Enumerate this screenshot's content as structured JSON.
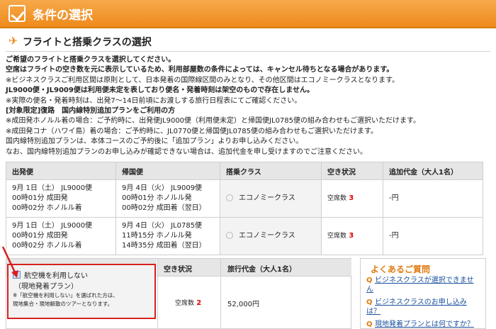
{
  "header": {
    "title": "条件の選択"
  },
  "subheader": {
    "title": "フライトと搭乗クラスの選択"
  },
  "intro": [
    {
      "text": "ご希望のフライトと搭乗クラスを選択してください。",
      "bold": true
    },
    {
      "text": "空席はフライトの空き数を元に表示しているため、利用部屋数の条件によっては、キャンセル待ちとなる場合があります。",
      "bold": true
    },
    {
      "text": "※ビジネスクラスご利用区間は原則として、日本発着の国際線区間のみとなり、その他区間はエコノミークラスとなります。",
      "bold": false
    },
    {
      "text": "JL9000便・JL9009便は利用便未定を表しており便名・発着時刻は架空のもので存在しません。",
      "bold": true
    },
    {
      "text": "※実際の便名・発着時刻は、出発7〜14日前頃にお渡しする旅行日程表にてご確認ください。",
      "bold": false
    },
    {
      "text": "[対象限定]復路　国内線特別追加プランをご利用の方",
      "bold": true
    },
    {
      "text": "※成田発ホノルル着の場合：ご予約時に、出発便JL9000便（利用便未定）と帰国便JL0785便の組み合わせもご選択いただけます。",
      "bold": false
    },
    {
      "text": "※成田発コナ（ハワイ島）着の場合：ご予約時に、JL0770便と帰国便JL0785便の組み合わせもご選択いただけます。",
      "bold": false
    },
    {
      "text": "国内線特別追加プランは、本体コースのご予約後に「追加プラン」よりお申し込みください。",
      "bold": false
    },
    {
      "text": "なお、国内線特別追加プランのお申し込みが確認できない場合は、追加代金を申し受けますのでご注意ください。",
      "bold": false
    }
  ],
  "flights": {
    "headers": [
      "出発便",
      "帰国便",
      "搭乗クラス",
      "空き状況",
      "追加代金（大人1名）"
    ],
    "rows": [
      {
        "out": [
          "9月 1日（土） JL9000便",
          "00時01分 成田発",
          "00時02分 ホノルル着"
        ],
        "ret": [
          "9月 4日（火） JL9009便",
          "00時01分 ホノルル発",
          "00時02分 成田着（翌日）"
        ],
        "cls": "エコノミークラス",
        "avail_label": "空席数",
        "avail": "3",
        "price": "-円"
      },
      {
        "out": [
          "9月 1日（土） JL9000便",
          "00時01分 成田発",
          "00時02分 ホノルル着"
        ],
        "ret": [
          "9月 4日（火） JL0785便",
          "11時15分 ホノルル発",
          "14時35分 成田着（翌日）"
        ],
        "cls": "エコノミークラス",
        "avail_label": "空席数",
        "avail": "3",
        "price": "-円"
      }
    ]
  },
  "plan": {
    "headers": {
      "avail": "空き状況",
      "price": "旅行代金（大人1名）"
    },
    "option_label": "航空機を利用しない",
    "option_sub": "（現地発着プラン）",
    "note1": "※「航空機を利用しない」を選ばれた方は、",
    "note2": "現地集合・現地解散のツアーとなります。",
    "avail_label": "空席数",
    "avail": "2",
    "price": "52,000円"
  },
  "faq": {
    "title": "よくあるご質問",
    "items": [
      "ビジネスクラスが選択できません",
      "ビジネスクラスのお申し込みは？",
      "現地発着プランとは何ですか？"
    ]
  }
}
